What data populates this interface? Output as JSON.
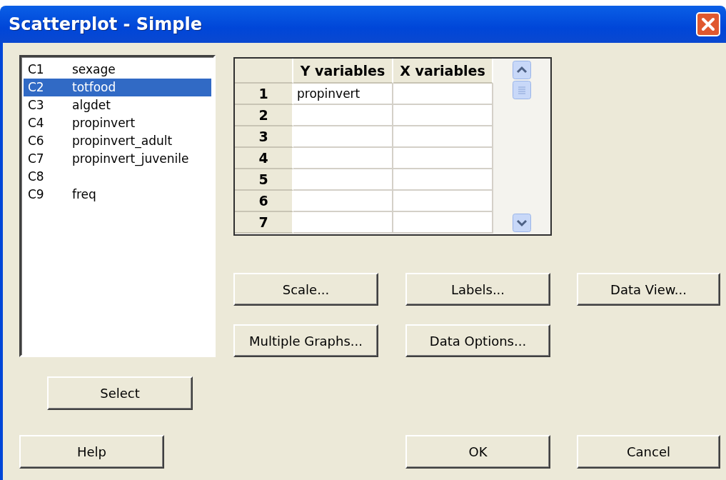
{
  "window": {
    "title": "Scatterplot - Simple"
  },
  "variables": [
    {
      "column": "C1",
      "name": "sexage",
      "selected": false
    },
    {
      "column": "C2",
      "name": "totfood",
      "selected": true
    },
    {
      "column": "C3",
      "name": "algdet",
      "selected": false
    },
    {
      "column": "C4",
      "name": "propinvert",
      "selected": false
    },
    {
      "column": "C6",
      "name": "propinvert_adult",
      "selected": false
    },
    {
      "column": "C7",
      "name": "propinvert_juvenile",
      "selected": false
    },
    {
      "column": "C8",
      "selected": false
    },
    {
      "column": "C9",
      "name": "freq",
      "selected": false
    }
  ],
  "table": {
    "columns": [
      "Y variables",
      "X variables"
    ],
    "rows": [
      {
        "number": "1",
        "y": "propinvert"
      },
      {
        "number": "2"
      },
      {
        "number": "3"
      },
      {
        "number": "4"
      },
      {
        "number": "5"
      },
      {
        "number": "6"
      },
      {
        "number": "7"
      }
    ]
  },
  "option_buttons": [
    "Scale...",
    "Labels...",
    "Data View...",
    "Multiple Graphs...",
    "Data Options..."
  ],
  "select_button": "Select",
  "footer_buttons": [
    "Help",
    "OK",
    "Cancel"
  ]
}
